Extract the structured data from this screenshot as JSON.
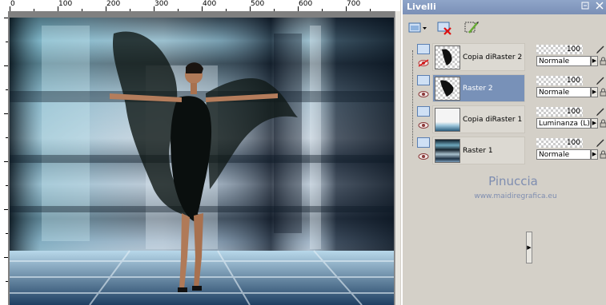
{
  "ruler": {
    "ticks": [
      "0",
      "100",
      "200",
      "300",
      "400",
      "500",
      "600",
      "700"
    ]
  },
  "palette": {
    "title": "Livelli",
    "title_controls": [
      "minimize-icon",
      "close-icon"
    ],
    "toolbar": [
      "new-layer-icon",
      "delete-layer-icon",
      "edit-layer-icon"
    ]
  },
  "layers": [
    {
      "name": "Copia diRaster 2",
      "opacity": "100",
      "blend": "Normale",
      "visible": false,
      "selected": false
    },
    {
      "name": "Raster 2",
      "opacity": "100",
      "blend": "Normale",
      "visible": true,
      "selected": true
    },
    {
      "name": "Copia diRaster 1",
      "opacity": "100",
      "blend": "Luminanza (L)",
      "visible": true,
      "selected": false
    },
    {
      "name": "Raster 1",
      "opacity": "100",
      "blend": "Normale",
      "visible": true,
      "selected": false
    }
  ],
  "watermark": {
    "line1": "Pinuccia",
    "line2": "www.maidiregrafica.eu"
  },
  "colors": {
    "palette_title": "#8fa5c9",
    "selected_row": "#7891b8",
    "watermark": "#7e8db0"
  }
}
